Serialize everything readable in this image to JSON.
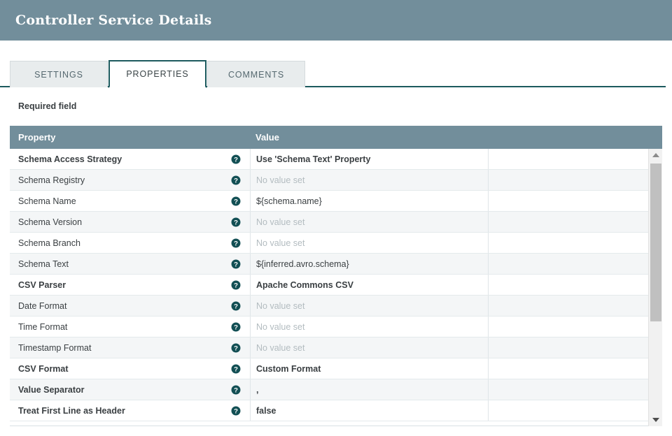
{
  "header": {
    "title": "Controller Service Details"
  },
  "tabs": [
    {
      "label": "SETTINGS",
      "active": false
    },
    {
      "label": "PROPERTIES",
      "active": true
    },
    {
      "label": "COMMENTS",
      "active": false
    }
  ],
  "notice": {
    "required_field_label": "Required field"
  },
  "table": {
    "columns": {
      "property": "Property",
      "value": "Value"
    },
    "help_icon": "help-icon",
    "rows": [
      {
        "property": "Schema Access Strategy",
        "required": true,
        "value": "Use 'Schema Text' Property",
        "unset": false
      },
      {
        "property": "Schema Registry",
        "required": false,
        "value": "No value set",
        "unset": true
      },
      {
        "property": "Schema Name",
        "required": false,
        "value": "${schema.name}",
        "unset": false
      },
      {
        "property": "Schema Version",
        "required": false,
        "value": "No value set",
        "unset": true
      },
      {
        "property": "Schema Branch",
        "required": false,
        "value": "No value set",
        "unset": true
      },
      {
        "property": "Schema Text",
        "required": false,
        "value": "${inferred.avro.schema}",
        "unset": false
      },
      {
        "property": "CSV Parser",
        "required": true,
        "value": "Apache Commons CSV",
        "unset": false
      },
      {
        "property": "Date Format",
        "required": false,
        "value": "No value set",
        "unset": true
      },
      {
        "property": "Time Format",
        "required": false,
        "value": "No value set",
        "unset": true
      },
      {
        "property": "Timestamp Format",
        "required": false,
        "value": "No value set",
        "unset": true
      },
      {
        "property": "CSV Format",
        "required": true,
        "value": "Custom Format",
        "unset": false
      },
      {
        "property": "Value Separator",
        "required": true,
        "value": ",",
        "unset": false
      },
      {
        "property": "Treat First Line as Header",
        "required": true,
        "value": "false",
        "unset": false
      }
    ]
  },
  "scrollbar": {
    "up_arrow": "chevron-up-icon",
    "down_arrow": "chevron-down-icon"
  },
  "colors": {
    "header_bar": "#728e9b",
    "accent_teal": "#1c5a5e",
    "row_alt": "#f4f6f7",
    "unset_text": "#b3bcc0"
  }
}
